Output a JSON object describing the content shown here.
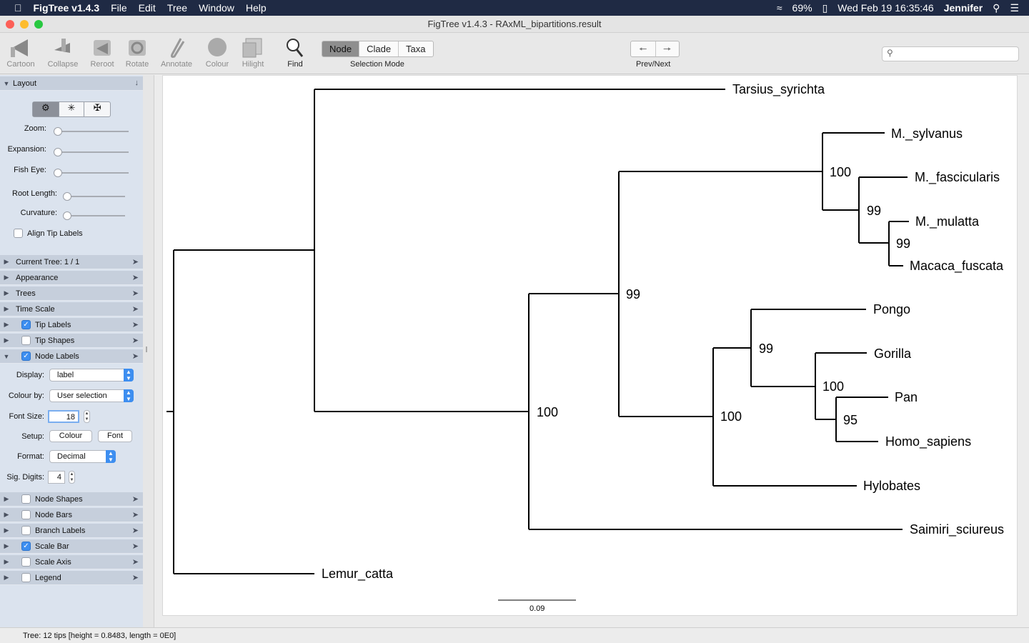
{
  "menubar": {
    "app_name": "FigTree v1.4.3",
    "menus": [
      "File",
      "Edit",
      "Tree",
      "Window",
      "Help"
    ],
    "battery": "69%",
    "clock": "Wed Feb 19  16:35:46",
    "user": "Jennifer"
  },
  "window": {
    "title": "FigTree v1.4.3 - RAxML_bipartitions.result"
  },
  "toolbar": {
    "tools": [
      {
        "label": "Cartoon",
        "icon": "cartoon-icon"
      },
      {
        "label": "Collapse",
        "icon": "collapse-icon"
      },
      {
        "label": "Reroot",
        "icon": "reroot-icon"
      },
      {
        "label": "Rotate",
        "icon": "rotate-icon"
      },
      {
        "label": "Annotate",
        "icon": "annotate-icon"
      },
      {
        "label": "Colour",
        "icon": "colour-icon"
      },
      {
        "label": "Hilight",
        "icon": "hilight-icon"
      },
      {
        "label": "Find",
        "icon": "find-icon"
      }
    ],
    "selection_mode": {
      "options": [
        "Node",
        "Clade",
        "Taxa"
      ],
      "selected": "Node",
      "label": "Selection Mode"
    },
    "prev_next_label": "Prev/Next",
    "search_placeholder": ""
  },
  "sidebar": {
    "layout": {
      "title": "Layout",
      "sliders": [
        {
          "label": "Zoom:",
          "value": 0.0
        },
        {
          "label": "Expansion:",
          "value": 0.0
        },
        {
          "label": "Fish Eye:",
          "value": 0.0
        },
        {
          "label": "Root Length:",
          "value": 0.0
        },
        {
          "label": "Curvature:",
          "value": 0.0
        }
      ],
      "align_tip_labels": {
        "label": "Align Tip Labels",
        "checked": false
      }
    },
    "panels_top": [
      {
        "label": "Current Tree: 1 / 1",
        "checkbox": null,
        "expanded": false
      },
      {
        "label": "Appearance",
        "checkbox": null,
        "expanded": false
      },
      {
        "label": "Trees",
        "checkbox": null,
        "expanded": false
      },
      {
        "label": "Time Scale",
        "checkbox": null,
        "expanded": false
      },
      {
        "label": "Tip Labels",
        "checkbox": true,
        "expanded": false
      },
      {
        "label": "Tip Shapes",
        "checkbox": false,
        "expanded": false
      },
      {
        "label": "Node Labels",
        "checkbox": true,
        "expanded": true
      }
    ],
    "node_labels": {
      "display_label": "Display:",
      "display_value": "label",
      "colour_by_label": "Colour by:",
      "colour_by_value": "User selection",
      "font_size_label": "Font Size:",
      "font_size_value": "18",
      "setup_label": "Setup:",
      "colour_button": "Colour",
      "font_button": "Font",
      "format_label": "Format:",
      "format_value": "Decimal",
      "sig_digits_label": "Sig. Digits:",
      "sig_digits_value": "4"
    },
    "panels_bottom": [
      {
        "label": "Node Shapes",
        "checkbox": false
      },
      {
        "label": "Node Bars",
        "checkbox": false
      },
      {
        "label": "Branch Labels",
        "checkbox": false
      },
      {
        "label": "Scale Bar",
        "checkbox": true
      },
      {
        "label": "Scale Axis",
        "checkbox": false
      },
      {
        "label": "Legend",
        "checkbox": false
      }
    ]
  },
  "tree": {
    "tips": [
      "Tarsius_syrichta",
      "M._sylvanus",
      "M._fascicularis",
      "M._mulatta",
      "Macaca_fuscata",
      "Pongo",
      "Gorilla",
      "Pan",
      "Homo_sapiens",
      "Hylobates",
      "Saimiri_sciureus",
      "Lemur_catta"
    ],
    "node_labels": [
      "100",
      "99",
      "99",
      "99",
      "99",
      "100",
      "95",
      "100",
      "100"
    ],
    "scale_bar_label": "0.09"
  },
  "status": {
    "text": "Tree: 12 tips [height = 0.8483, length = 0E0]"
  },
  "colors": {
    "menubar_bg": "#1f2a44",
    "sidebar_bg": "#dbe3ee",
    "accent": "#3d8ef0"
  }
}
